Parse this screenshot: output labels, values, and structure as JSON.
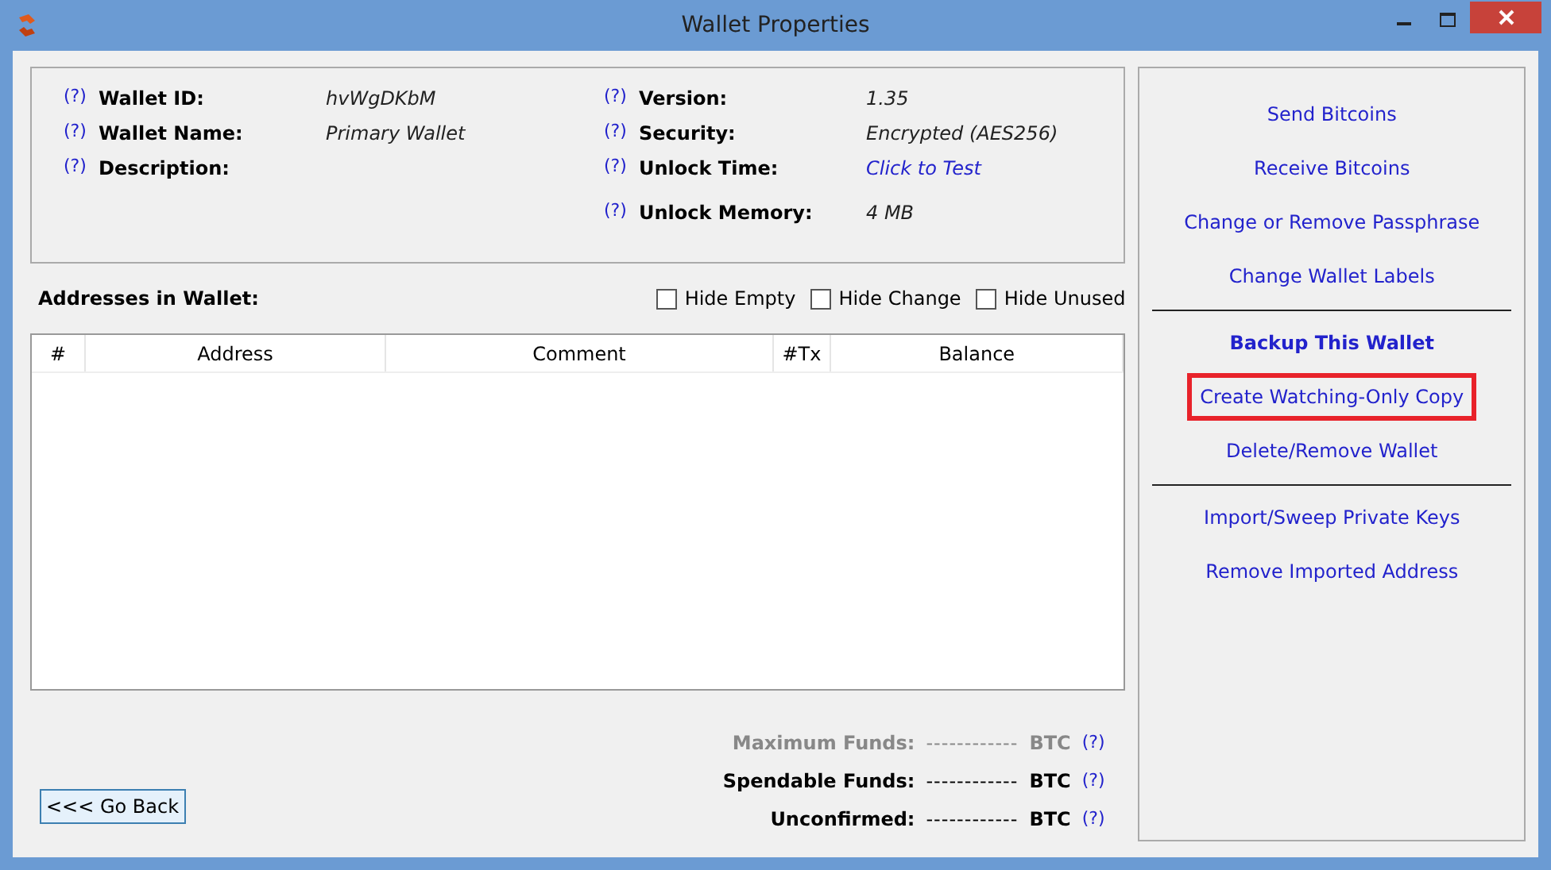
{
  "window": {
    "title": "Wallet Properties"
  },
  "info_left": [
    {
      "label": "Wallet ID:",
      "help": "(?)",
      "value": "hvWgDKbM",
      "link": false
    },
    {
      "label": "Wallet Name:",
      "help": "(?)",
      "value": "Primary Wallet",
      "link": false
    },
    {
      "label": "Description:",
      "help": "(?)"
    }
  ],
  "info_right": [
    {
      "label": "Version:",
      "help": "(?)",
      "value": "1.35",
      "link": false
    },
    {
      "label": "Security:",
      "help": "(?)",
      "value": "Encrypted (AES256)",
      "link": false
    },
    {
      "label": "Unlock Time:",
      "help": "(?)",
      "value": "Click to Test",
      "link": true
    },
    {
      "label": "Unlock Memory:",
      "help": "(?)",
      "value": "4 MB",
      "link": false
    }
  ],
  "addresses_label": "Addresses in Wallet:",
  "filters": [
    {
      "label": "Hide Empty",
      "checked": false
    },
    {
      "label": "Hide Change",
      "checked": false
    },
    {
      "label": "Hide Unused",
      "checked": false
    }
  ],
  "table": {
    "columns": [
      "#",
      "Address",
      "Comment",
      "#Tx",
      "Balance"
    ]
  },
  "back_button": "<<< Go Back",
  "funds": [
    {
      "label": "Maximum Funds:",
      "amount": "------------",
      "unit": "BTC",
      "help": "(?)",
      "dimmed": true
    },
    {
      "label": "Spendable Funds:",
      "amount": "------------",
      "unit": "BTC",
      "help": "(?)",
      "dimmed": false
    },
    {
      "label": "Unconfirmed:",
      "amount": "------------",
      "unit": "BTC",
      "help": "(?)",
      "dimmed": false
    }
  ],
  "action_groups": [
    [
      {
        "label": "Send Bitcoins",
        "bold": false,
        "highlighted": false
      },
      {
        "label": "Receive Bitcoins",
        "bold": false,
        "highlighted": false
      },
      {
        "label": "Change or Remove Passphrase",
        "bold": false,
        "highlighted": false
      },
      {
        "label": "Change Wallet Labels",
        "bold": false,
        "highlighted": false
      }
    ],
    [
      {
        "label": "Backup This Wallet",
        "bold": true,
        "highlighted": false
      },
      {
        "label": "Create Watching-Only Copy",
        "bold": false,
        "highlighted": true
      },
      {
        "label": "Delete/Remove Wallet",
        "bold": false,
        "highlighted": false
      }
    ],
    [
      {
        "label": "Import/Sweep Private Keys",
        "bold": false,
        "highlighted": false
      },
      {
        "label": "Remove Imported Address",
        "bold": false,
        "highlighted": false
      }
    ]
  ]
}
